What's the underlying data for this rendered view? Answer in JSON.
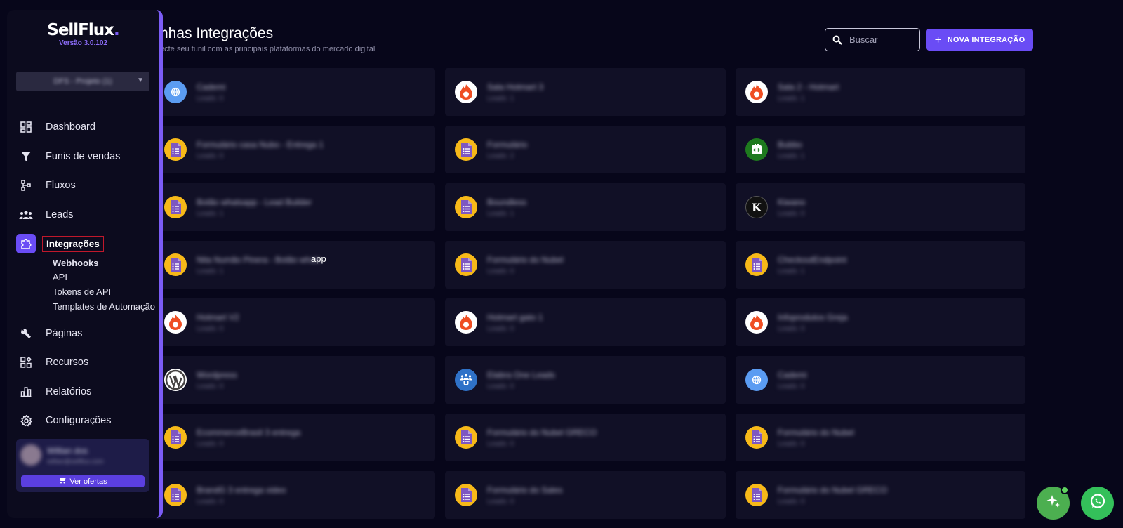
{
  "header": {
    "title": "nhas Integrações",
    "subtitle": "ecte seu funil com as principais plataformas do mercado digital"
  },
  "search": {
    "placeholder": "Buscar"
  },
  "new_button": {
    "label": "NOVA INTEGRAÇÃO"
  },
  "sidebar": {
    "logo_text": "SellFlux",
    "logo_dot": ".",
    "version": "Versão 3.0.102",
    "project": "DFS - Projeto (1)",
    "nav": [
      {
        "label": "Dashboard",
        "icon": "dashboard-icon"
      },
      {
        "label": "Funis de vendas",
        "icon": "funnel-icon"
      },
      {
        "label": "Fluxos",
        "icon": "flow-icon"
      },
      {
        "label": "Leads",
        "icon": "leads-icon"
      },
      {
        "label": "Integrações",
        "icon": "puzzle-icon"
      },
      {
        "label": "Páginas",
        "icon": "wrench-icon"
      },
      {
        "label": "Recursos",
        "icon": "resources-icon"
      },
      {
        "label": "Relatórios",
        "icon": "chart-icon"
      },
      {
        "label": "Configurações",
        "icon": "gear-icon"
      }
    ],
    "sub_items": [
      "Webhooks",
      "API",
      "Tokens de API",
      "Templates de Automação"
    ],
    "user": {
      "name": "Willian dos",
      "email": "willian@sellflux.com"
    },
    "offers_label": "Ver ofertas"
  },
  "integrations": [
    {
      "name": "Cademi",
      "sub": "Leads: 0",
      "icon": "cademi-icon"
    },
    {
      "name": "Sala Hotmart 3",
      "sub": "Leads: 1",
      "icon": "hotmart-icon"
    },
    {
      "name": "Sala 2 - Hotmart",
      "sub": "Leads: 1",
      "icon": "hotmart-icon"
    },
    {
      "name": "Formulário casa Nubo - Entrega 1",
      "sub": "Leads: 0",
      "icon": "google-forms-icon"
    },
    {
      "name": "Formulário",
      "sub": "Leads: 2",
      "icon": "google-forms-icon"
    },
    {
      "name": "Bubbo",
      "sub": "Leads: 1",
      "icon": "code-icon"
    },
    {
      "name": "Botão whatsapp - Lead Builder",
      "sub": "Leads: 1",
      "icon": "google-forms-icon"
    },
    {
      "name": "Boundless",
      "sub": "Leads: 1",
      "icon": "google-forms-icon"
    },
    {
      "name": "Kiwano",
      "sub": "Leads: 0",
      "icon": "kiwify-icon"
    },
    {
      "name": "Nita Numão Pinera - Botão whats",
      "sub": "Leads: 1",
      "icon": "google-forms-icon",
      "extra": "app"
    },
    {
      "name": "Formulário do Nubel",
      "sub": "Leads: 0",
      "icon": "google-forms-icon"
    },
    {
      "name": "CheckoutEndpoint",
      "sub": "Leads: 1",
      "icon": "google-forms-icon"
    },
    {
      "name": "Hotmart V2",
      "sub": "Leads: 0",
      "icon": "hotmart-icon"
    },
    {
      "name": "Hotmart gato 1",
      "sub": "Leads: 0",
      "icon": "hotmart-icon"
    },
    {
      "name": "Infoprodutos Greja",
      "sub": "Leads: 0",
      "icon": "hotmart-icon"
    },
    {
      "name": "Wordpress",
      "sub": "Leads: 0",
      "icon": "wordpress-icon"
    },
    {
      "name": "Elabra One Leads",
      "sub": "Leads: 0",
      "icon": "users-icon"
    },
    {
      "name": "Cademi",
      "sub": "Leads: 0",
      "icon": "cademi-icon"
    },
    {
      "name": "EcommerceBrasil 3 entrega",
      "sub": "Leads: 0",
      "icon": "google-forms-icon"
    },
    {
      "name": "Formulário do Nubel GRECO",
      "sub": "Leads: 0",
      "icon": "google-forms-icon"
    },
    {
      "name": "Formulário do Nubel",
      "sub": "Leads: 0",
      "icon": "google-forms-icon"
    },
    {
      "name": "BrandG 3 entrega video",
      "sub": "Leads: 0",
      "icon": "google-forms-icon"
    },
    {
      "name": "Formulário do Sales",
      "sub": "Leads: 0",
      "icon": "google-forms-icon"
    },
    {
      "name": "Formulário do Nubel GRECO",
      "sub": "Leads: 0",
      "icon": "google-forms-icon"
    }
  ],
  "colors": {
    "accent": "#6a4cf5",
    "background": "#07061a",
    "card": "#111026",
    "whatsapp": "#34c05a"
  }
}
